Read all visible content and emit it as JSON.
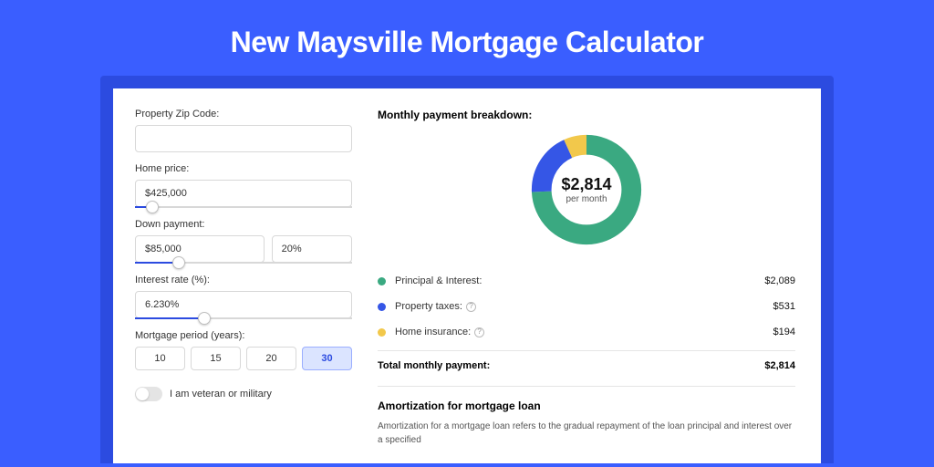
{
  "title": "New Maysville Mortgage Calculator",
  "colors": {
    "principal": "#3aa981",
    "taxes": "#3556e6",
    "insurance": "#f2c84b"
  },
  "form": {
    "zip": {
      "label": "Property Zip Code:",
      "value": ""
    },
    "price": {
      "label": "Home price:",
      "value": "$425,000",
      "slider_pct": 8
    },
    "down": {
      "label": "Down payment:",
      "amount": "$85,000",
      "pct": "20%",
      "slider_pct": 20
    },
    "rate": {
      "label": "Interest rate (%):",
      "value": "6.230%",
      "slider_pct": 32
    },
    "period": {
      "label": "Mortgage period (years):",
      "options": [
        "10",
        "15",
        "20",
        "30"
      ],
      "selected": "30"
    },
    "veteran": {
      "label": "I am veteran or military",
      "checked": false
    }
  },
  "breakdown": {
    "title": "Monthly payment breakdown:",
    "center_amount": "$2,814",
    "center_sub": "per month",
    "items": [
      {
        "key": "principal",
        "label": "Principal & Interest:",
        "value": "$2,089",
        "info": false
      },
      {
        "key": "taxes",
        "label": "Property taxes:",
        "value": "$531",
        "info": true
      },
      {
        "key": "insurance",
        "label": "Home insurance:",
        "value": "$194",
        "info": true
      }
    ],
    "total_label": "Total monthly payment:",
    "total_value": "$2,814"
  },
  "amortization": {
    "title": "Amortization for mortgage loan",
    "text": "Amortization for a mortgage loan refers to the gradual repayment of the loan principal and interest over a specified"
  },
  "chart_data": {
    "type": "pie",
    "title": "Monthly payment breakdown",
    "series": [
      {
        "name": "Principal & Interest",
        "value": 2089
      },
      {
        "name": "Property taxes",
        "value": 531
      },
      {
        "name": "Home insurance",
        "value": 194
      }
    ],
    "total": 2814
  }
}
